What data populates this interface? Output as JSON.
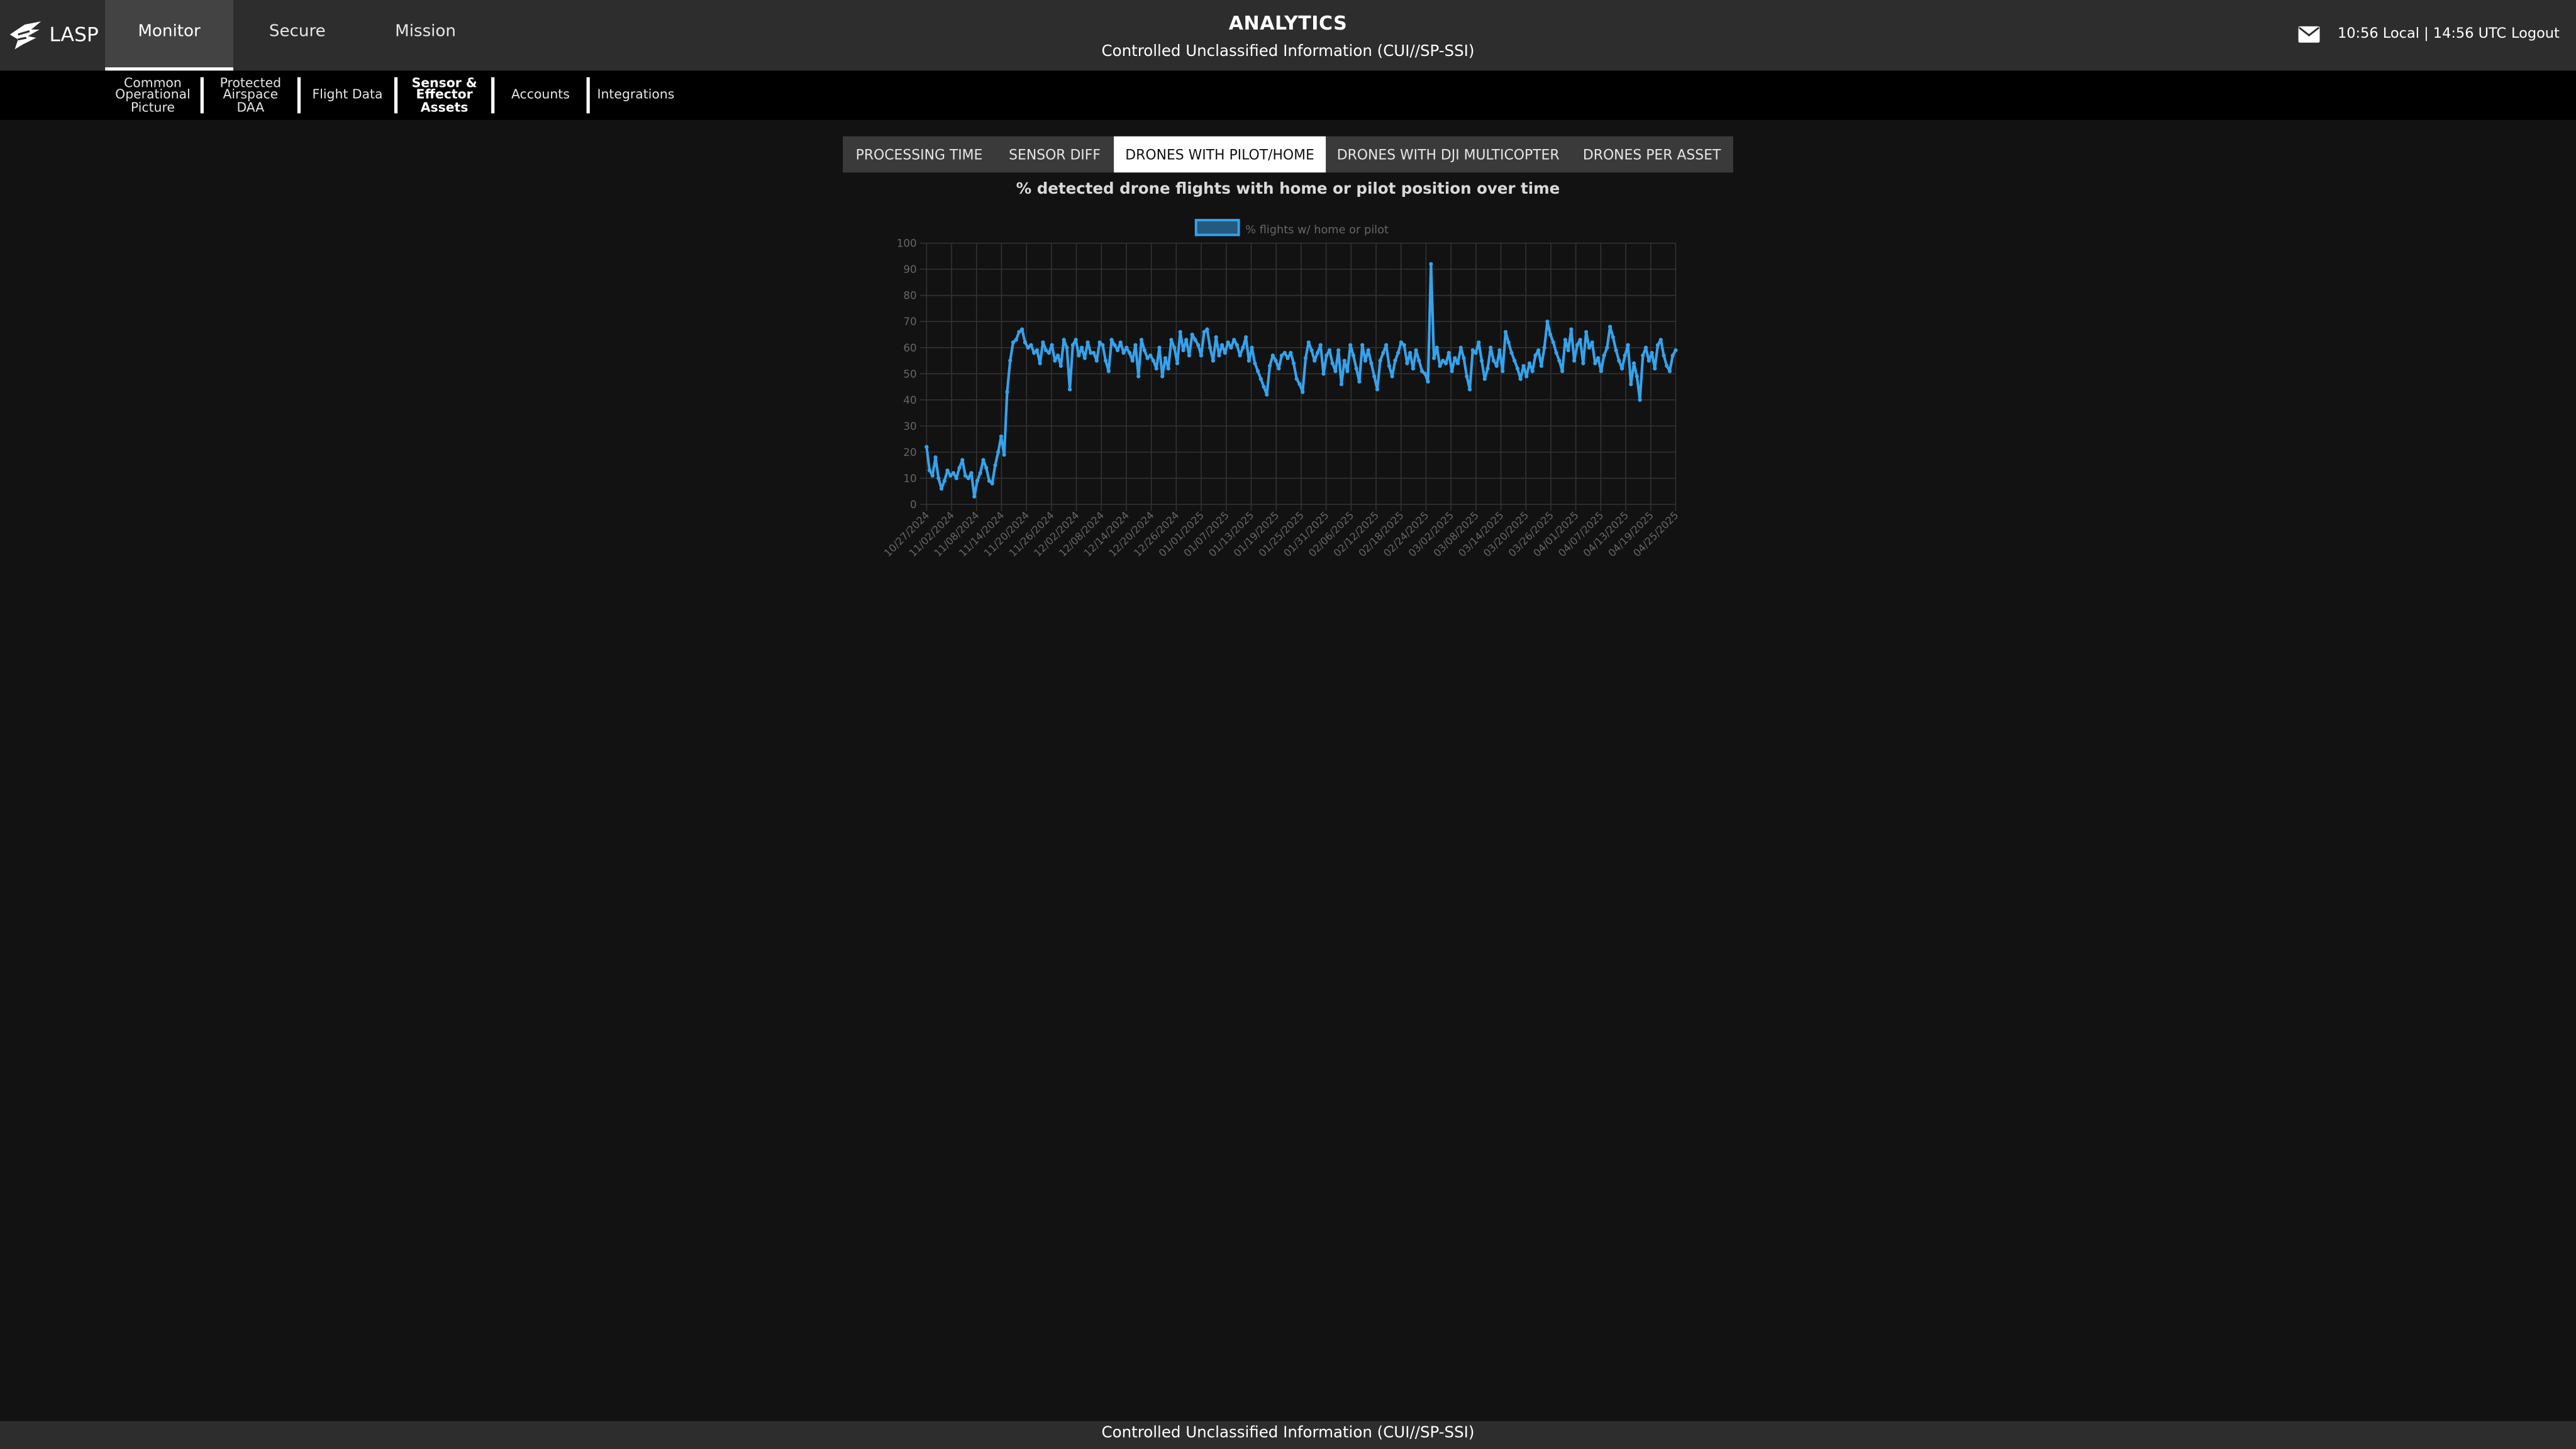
{
  "header": {
    "brand": "LASP",
    "tabs": [
      {
        "label": "Monitor",
        "active": true
      },
      {
        "label": "Secure",
        "active": false
      },
      {
        "label": "Mission",
        "active": false
      }
    ],
    "title": "ANALYTICS",
    "subtitle": "Controlled Unclassified Information (CUI//SP-SSI)",
    "clock": "10:56 Local | 14:56 UTC",
    "logout": "Logout"
  },
  "subnav": {
    "items": [
      {
        "label": "Common\nOperational\nPicture"
      },
      {
        "label": "Protected\nAirspace\nDAA"
      },
      {
        "label": "Flight Data"
      },
      {
        "label": "Sensor &\nEffector\nAssets"
      },
      {
        "label": "Accounts"
      },
      {
        "label": "Integrations"
      }
    ]
  },
  "analytics_tabs": [
    {
      "label": "PROCESSING TIME",
      "active": false
    },
    {
      "label": "SENSOR DIFF",
      "active": false
    },
    {
      "label": "DRONES WITH PILOT/HOME",
      "active": true
    },
    {
      "label": "DRONES WITH DJI MULTICOPTER",
      "active": false
    },
    {
      "label": "DRONES PER ASSET",
      "active": false
    }
  ],
  "chart_data": {
    "type": "line",
    "title": "% detected drone flights with home or pilot position over time",
    "legend": "% flights w/ home or pilot",
    "legend_position": "top",
    "ylim": [
      0,
      100
    ],
    "yticks": [
      0,
      10,
      20,
      30,
      40,
      50,
      60,
      70,
      80,
      90,
      100
    ],
    "grid": true,
    "x_tick_labels": [
      "10/27/2024",
      "11/02/2024",
      "11/08/2024",
      "11/14/2024",
      "11/20/2024",
      "11/26/2024",
      "12/02/2024",
      "12/08/2024",
      "12/14/2024",
      "12/20/2024",
      "12/26/2024",
      "01/01/2025",
      "01/07/2025",
      "01/13/2025",
      "01/19/2025",
      "01/25/2025",
      "01/31/2025",
      "02/06/2025",
      "02/12/2025",
      "02/18/2025",
      "02/24/2025",
      "03/02/2025",
      "03/08/2025",
      "03/14/2025",
      "03/20/2025",
      "03/26/2025",
      "04/01/2025",
      "04/07/2025",
      "04/13/2025",
      "04/19/2025",
      "04/25/2025"
    ],
    "values": [
      22,
      13,
      11,
      18,
      10,
      6,
      9,
      13,
      11,
      12,
      10,
      14,
      17,
      11,
      10,
      12,
      3,
      9,
      12,
      17,
      14,
      9,
      8,
      15,
      20,
      26,
      19,
      43,
      55,
      62,
      63,
      66,
      67,
      62,
      60,
      61,
      58,
      59,
      54,
      62,
      59,
      58,
      61,
      55,
      57,
      53,
      63,
      60,
      44,
      61,
      63,
      57,
      60,
      56,
      62,
      58,
      58,
      55,
      62,
      61,
      55,
      51,
      63,
      61,
      59,
      62,
      58,
      60,
      58,
      55,
      61,
      49,
      63,
      59,
      56,
      57,
      55,
      52,
      60,
      49,
      56,
      52,
      63,
      60,
      54,
      66,
      59,
      63,
      57,
      65,
      63,
      61,
      57,
      66,
      67,
      60,
      55,
      64,
      57,
      61,
      58,
      62,
      60,
      63,
      61,
      57,
      60,
      64,
      55,
      60,
      54,
      51,
      48,
      45,
      42,
      53,
      57,
      55,
      52,
      57,
      58,
      56,
      58,
      54,
      48,
      46,
      43,
      56,
      62,
      59,
      55,
      58,
      61,
      50,
      57,
      59,
      54,
      51,
      59,
      46,
      55,
      51,
      61,
      57,
      52,
      47,
      61,
      55,
      59,
      54,
      49,
      44,
      55,
      58,
      61,
      53,
      49,
      55,
      58,
      62,
      61,
      54,
      58,
      52,
      59,
      55,
      51,
      50,
      47,
      92,
      56,
      60,
      53,
      55,
      54,
      58,
      51,
      56,
      54,
      60,
      56,
      49,
      44,
      59,
      58,
      62,
      55,
      48,
      52,
      60,
      55,
      53,
      59,
      51,
      66,
      62,
      58,
      55,
      52,
      48,
      53,
      49,
      54,
      51,
      57,
      59,
      53,
      60,
      70,
      65,
      62,
      58,
      55,
      51,
      63,
      59,
      67,
      55,
      61,
      63,
      54,
      66,
      60,
      62,
      54,
      56,
      51,
      57,
      60,
      68,
      64,
      59,
      55,
      52,
      57,
      61,
      46,
      54,
      49,
      40,
      57,
      60,
      55,
      58,
      52,
      61,
      63,
      57,
      53,
      51,
      57,
      59
    ],
    "color": "#36a2eb"
  },
  "footer": "Controlled Unclassified Information (CUI//SP-SSI)"
}
